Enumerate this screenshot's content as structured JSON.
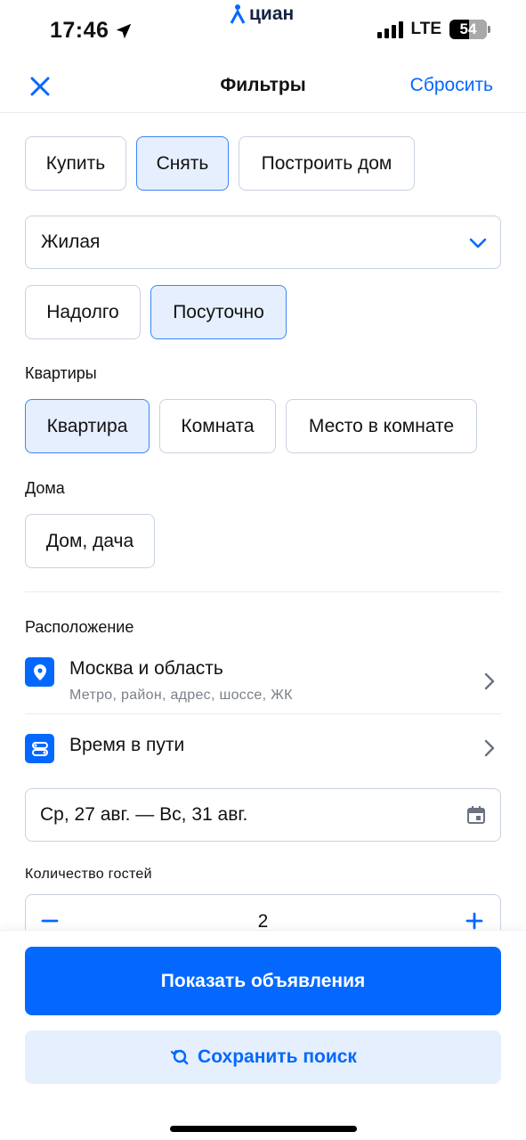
{
  "status_bar": {
    "time": "17:46",
    "network": "LTE",
    "battery": "54",
    "brand": "циан"
  },
  "header": {
    "title": "Фильтры",
    "reset_label": "Сбросить"
  },
  "deal_type": {
    "options": [
      "Купить",
      "Снять",
      "Построить дом"
    ],
    "selected": "Снять"
  },
  "property_type": {
    "value": "Жилая"
  },
  "rent_term": {
    "options": [
      "Надолго",
      "Посуточно"
    ],
    "selected": "Посуточно"
  },
  "apartments": {
    "label": "Квартиры",
    "options": [
      "Квартира",
      "Комната",
      "Место в комнате"
    ],
    "selected": "Квартира"
  },
  "houses": {
    "label": "Дома",
    "options": [
      "Дом, дача"
    ]
  },
  "location": {
    "label": "Расположение",
    "region_title": "Москва и область",
    "region_hint": "Метро, район, адрес, шоссе, ЖК",
    "travel_time": "Время в пути"
  },
  "dates": {
    "value": "Ср, 27 авг. — Вс, 31 авг."
  },
  "guests": {
    "label": "Количество гостей",
    "value": "2"
  },
  "actions": {
    "show_label": "Показать объявления",
    "save_label": "Сохранить поиск"
  },
  "colors": {
    "accent": "#0468ff",
    "chip_active_bg": "#e6effd",
    "border": "#c9d1e0"
  }
}
